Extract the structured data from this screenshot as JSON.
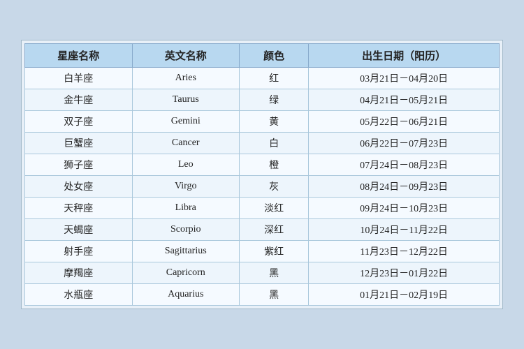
{
  "table": {
    "headers": [
      "星座名称",
      "英文名称",
      "颜色",
      "出生日期（阳历）"
    ],
    "rows": [
      [
        "白羊座",
        "Aries",
        "红",
        "03月21日－04月20日"
      ],
      [
        "金牛座",
        "Taurus",
        "绿",
        "04月21日－05月21日"
      ],
      [
        "双子座",
        "Gemini",
        "黄",
        "05月22日－06月21日"
      ],
      [
        "巨蟹座",
        "Cancer",
        "白",
        "06月22日－07月23日"
      ],
      [
        "狮子座",
        "Leo",
        "橙",
        "07月24日－08月23日"
      ],
      [
        "处女座",
        "Virgo",
        "灰",
        "08月24日－09月23日"
      ],
      [
        "天秤座",
        "Libra",
        "淡红",
        "09月24日－10月23日"
      ],
      [
        "天蝎座",
        "Scorpio",
        "深红",
        "10月24日－11月22日"
      ],
      [
        "射手座",
        "Sagittarius",
        "紫红",
        "11月23日－12月22日"
      ],
      [
        "摩羯座",
        "Capricorn",
        "黑",
        "12月23日－01月22日"
      ],
      [
        "水瓶座",
        "Aquarius",
        "黑",
        "01月21日－02月19日"
      ]
    ]
  }
}
